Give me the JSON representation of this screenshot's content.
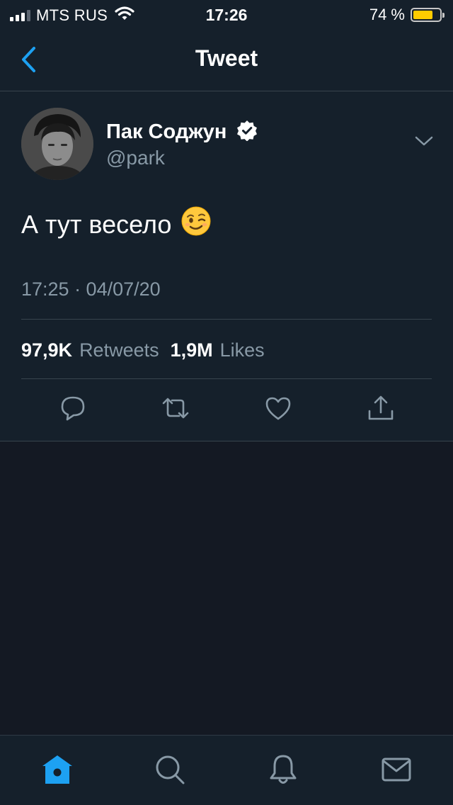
{
  "status_bar": {
    "carrier": "MTS RUS",
    "time": "17:26",
    "battery_percent": "74 %",
    "battery_level": 0.74,
    "battery_color": "#ffcc00"
  },
  "nav": {
    "title": "Tweet"
  },
  "tweet": {
    "author_name": "Пак Соджун",
    "handle": "@park",
    "verified": true,
    "text": "А тут весело",
    "emoji": "😉",
    "timestamp": "17:25 · 04/07/20",
    "retweets_count": "97,9K",
    "retweets_label": "Retweets",
    "likes_count": "1,9M",
    "likes_label": "Likes"
  },
  "actions": [
    {
      "icon": "reply-icon"
    },
    {
      "icon": "retweet-icon"
    },
    {
      "icon": "like-icon"
    },
    {
      "icon": "share-icon"
    }
  ],
  "tab_bar": [
    {
      "icon": "home-icon",
      "active": true
    },
    {
      "icon": "search-icon",
      "active": false
    },
    {
      "icon": "notifications-icon",
      "active": false
    },
    {
      "icon": "messages-icon",
      "active": false
    }
  ],
  "colors": {
    "accent": "#1da1f2",
    "background": "#15202b",
    "secondary_text": "#8899a6"
  }
}
